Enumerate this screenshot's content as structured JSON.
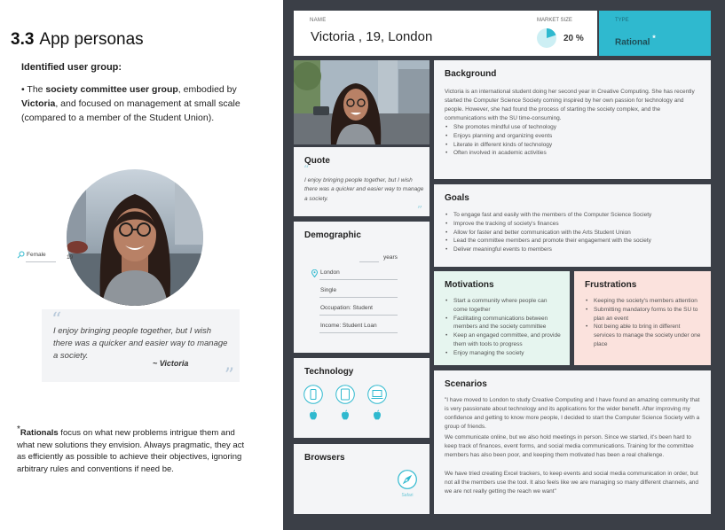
{
  "section": {
    "number": "3.3",
    "title": "App personas"
  },
  "user_group": {
    "heading": "Identified user group:",
    "desc_prefix": "• The ",
    "desc_bold1": "society committee user group",
    "desc_mid": ", embodied by ",
    "desc_bold2": "Victoria",
    "desc_suffix": ", and focused on management at small scale (compared to a member of the Student Union)."
  },
  "left_quote": {
    "open_mark": "“",
    "text": "I enjoy bringing people together, but I wish there was a quicker and easier way to manage a society.",
    "author": "~ Victoria",
    "close_mark": "”"
  },
  "rationals_note": {
    "marker": "*",
    "bold": "Rationals",
    "text": " focus on what new problems intrigue them and what new solutions they envision. Always pragmatic, they act as efficiently as possible to achieve their objectives, ignoring arbitrary rules and conventions if need be."
  },
  "persona": {
    "name_label": "NAME",
    "name": "Victoria , 19, London",
    "market_label": "MARKET SIZE",
    "market_size": "20 %",
    "market_fraction": 0.2,
    "type_label": "TYPE",
    "type": "Rational",
    "type_marker": "*"
  },
  "quote_card": {
    "title": "Quote",
    "open_mark": "“",
    "text": "I enjoy bringing people together, but I wish there was a quicker and easier way to manage a society.",
    "close_mark": "”"
  },
  "demographic": {
    "title": "Demographic",
    "gender": "Female",
    "age": "19",
    "age_unit": "years",
    "location": "London",
    "status": "Single",
    "occupation": "Occupation: Student",
    "income": "Income: Student Loan"
  },
  "technology": {
    "title": "Technology",
    "devices": [
      "phone-icon",
      "tablet-icon",
      "laptop-icon"
    ],
    "os": [
      "apple-icon",
      "apple-icon",
      "apple-icon"
    ]
  },
  "browsers": {
    "title": "Browsers",
    "items": [
      {
        "icon": "safari-icon",
        "label": "Safari"
      }
    ]
  },
  "background": {
    "title": "Background",
    "text": "Victoria is an international student doing her second year in Creative Computing. She has recently started the Computer Science Society coming inspired by her own passion for technology and people. However, she had found the process of starting the society complex, and the communications with the SU time-consuming.",
    "bullets": [
      "She promotes mindful use of technology",
      "Enjoys planning and organizing events",
      "Literate in different kinds of technology",
      "Often involved in academic activities"
    ]
  },
  "goals": {
    "title": "Goals",
    "bullets": [
      "To engage fast and easily with the members of the Computer Science Society",
      "Improve the tracking of society's finances",
      "Allow for faster and better communication with the Arts Student Union",
      "Lead the committee members and promote their engagement with the society",
      "Deliver meaningful events to members"
    ]
  },
  "motivations": {
    "title": "Motivations",
    "bullets": [
      "Start a community where people can come together",
      "Facilitating communications between members and the society committee",
      "Keep an engaged committee, and provide them with tools to progress",
      "Enjoy managing the society"
    ]
  },
  "frustrations": {
    "title": "Frustrations",
    "bullets": [
      "Keeping the society's members attention",
      "Submitting mandatory forms to the SU to plan an event",
      "Not being able to bring in different services to manage the society under one place"
    ]
  },
  "scenarios": {
    "title": "Scenarios",
    "paragraphs": [
      "\"I have moved to London to study Creative Computing and I have found an amazing community that is very passionate about technology and its applications for the wider benefit. After improving my confidence and getting to know more people, I decided to start the Computer Science Society with a group of friends.",
      "We communicate online, but we also hold meetings in person. Since we started, it's been hard to keep track of finances, event forms, and social media communications. Training for the committee members has also been poor, and keeping them motivated has been a real challenge.",
      "We have tried creating Excel trackers, to keep events and social media communication in order, but not all the members use the tool. It also feels like we are managing so many different channels, and we are not really getting the reach we want\""
    ]
  },
  "colors": {
    "board": "#3b3f47",
    "card": "#f4f5f7",
    "accent": "#2fb9cf",
    "motivations": "#e6f5ef",
    "frustrations": "#fbe2dd"
  }
}
